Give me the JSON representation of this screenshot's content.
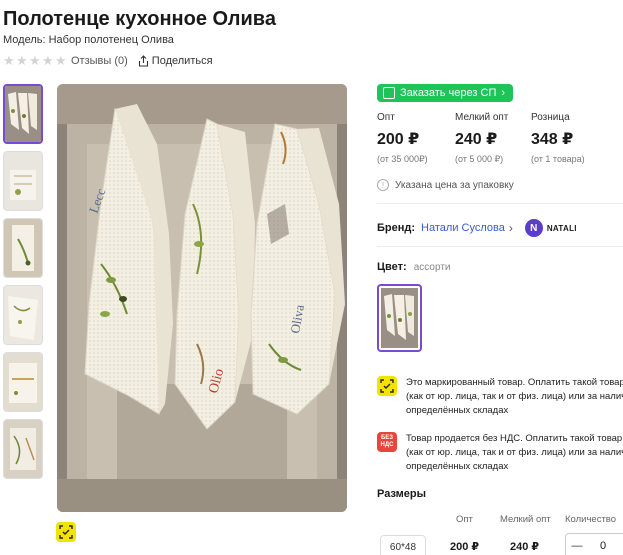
{
  "product": {
    "title": "Полотенце кухонное Олива",
    "model_label": "Модель: Набор полотенец Олива",
    "reviews": "Отзывы (0)",
    "share": "Поделиться",
    "rating": 0,
    "rating_max": 5
  },
  "order_button": {
    "label": "Заказать через СП",
    "chevron": "›"
  },
  "prices": [
    {
      "label": "Опт",
      "value": "200 ₽",
      "sub": "(от 35 000₽)"
    },
    {
      "label": "Мелкий опт",
      "value": "240 ₽",
      "sub": "(от 5 000 ₽)"
    },
    {
      "label": "Розница",
      "value": "348 ₽",
      "sub": "(от 1 товара)"
    }
  ],
  "price_note": "Указана цена за упаковку",
  "brand": {
    "key": "Бренд:",
    "value": "Натали Суслова",
    "chevron": "›",
    "logo_text": "NATALI",
    "logo_letter": "N"
  },
  "color": {
    "key": "Цвет:",
    "value": "ассорти"
  },
  "badges": [
    {
      "icon": "marking-icon",
      "lines": [
        "Это маркированный товар. Оплатить такой товар",
        "(как от юр. лица, так и от физ. лица) или за наличн",
        "определённых складах"
      ]
    },
    {
      "icon": "no-vat-icon",
      "icon_text": "БЕЗ НДС",
      "lines": [
        "Товар продается без НДС. Оплатить такой товар м",
        "(как от юр. лица, так и от физ. лица) или за наличн",
        "определённых складах"
      ]
    }
  ],
  "sizes": {
    "title": "Размеры",
    "headers": [
      "Опт",
      "Мелкий опт",
      "Количество"
    ],
    "rows": [
      {
        "size": "60*48",
        "opt": "200 ₽",
        "small_opt": "240 ₽",
        "qty": "0",
        "minus": "—"
      }
    ]
  },
  "colors": {
    "accent": "#7a4ad7",
    "green": "#1ec45a",
    "link": "#3a5bc7",
    "marking": "#f2e300",
    "novat": "#e8463a"
  }
}
